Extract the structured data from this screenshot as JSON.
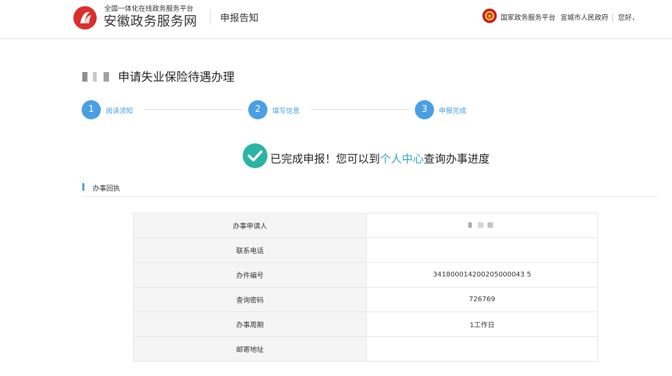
{
  "header": {
    "logo_subtitle": "全国一体化在线政务服务平台",
    "logo_title": "安徽政务服务网",
    "section_title": "申报告知",
    "links": [
      "国家政务服务平台",
      "宣城市人民政府"
    ],
    "greeting": "您好，",
    "brand_color": "#d9302c"
  },
  "page": {
    "title": "申请失业保险待遇办理"
  },
  "steps": [
    {
      "number": "1",
      "label": "阅读须知"
    },
    {
      "number": "2",
      "label": "填写信息"
    },
    {
      "number": "3",
      "label": "申报完成"
    }
  ],
  "success": {
    "prefix": "已完成申报！您可以到",
    "link": "个人中心",
    "suffix": "查询办事进度"
  },
  "receipt": {
    "section_title": "办事回执",
    "rows": [
      {
        "label": "办事申请人",
        "value": ""
      },
      {
        "label": "联系电话",
        "value": ""
      },
      {
        "label": "办件编号",
        "value": "341800014200205000043 5"
      },
      {
        "label": "查询密码",
        "value": "726769"
      },
      {
        "label": "办事周期",
        "value": "1工作日"
      },
      {
        "label": "邮寄地址",
        "value": ""
      }
    ]
  },
  "colors": {
    "accent": "#4a9fe2",
    "success": "#2bb3a3",
    "link": "#2aa4c7"
  }
}
